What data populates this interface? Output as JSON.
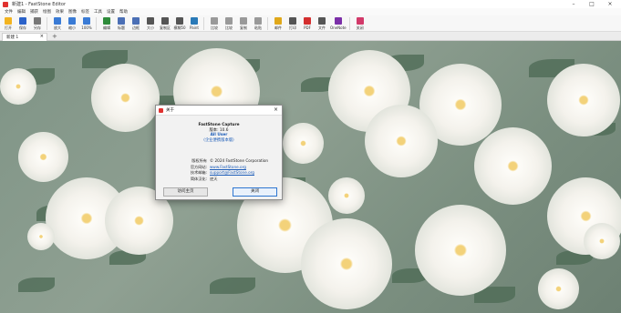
{
  "window": {
    "title": "新建1 - FastStone Editor"
  },
  "menu": [
    "文件",
    "编辑",
    "捕获",
    "绘图",
    "效果",
    "图像",
    "标签",
    "工具",
    "设置",
    "帮助"
  ],
  "toolbar": [
    {
      "label": "打开",
      "icon": "folder-open-icon",
      "color": "#f2b320"
    },
    {
      "label": "保存",
      "icon": "save-icon",
      "color": "#2b62c9"
    },
    {
      "label": "另存",
      "icon": "save-as-icon",
      "color": "#777777"
    },
    {
      "label": "放大",
      "icon": "zoom-in-icon",
      "color": "#3a7bd5"
    },
    {
      "label": "缩小",
      "icon": "zoom-out-icon",
      "color": "#3a7bd5"
    },
    {
      "label": "100%",
      "icon": "actual-size-icon",
      "color": "#3a7bd5"
    },
    {
      "label": "编辑",
      "icon": "edit-icon",
      "color": "#2e8b3a"
    },
    {
      "label": "标题",
      "icon": "caption-icon",
      "color": "#4b6fb5"
    },
    {
      "label": "边框",
      "icon": "border-icon",
      "color": "#4b6fb5"
    },
    {
      "label": "大小",
      "icon": "resize-icon",
      "color": "#555555"
    },
    {
      "label": "复制区",
      "icon": "copy-area-icon",
      "color": "#555555"
    },
    {
      "label": "模糊50",
      "icon": "blur-icon",
      "color": "#555555"
    },
    {
      "label": "Paint",
      "icon": "paint-icon",
      "color": "#2a7ab8"
    },
    {
      "label": "比较",
      "icon": "compare-icon",
      "color": "#999999"
    },
    {
      "label": "比较",
      "icon": "cut-icon",
      "color": "#999999"
    },
    {
      "label": "复制",
      "icon": "copy-icon",
      "color": "#999999"
    },
    {
      "label": "粘贴",
      "icon": "paste-icon",
      "color": "#999999"
    },
    {
      "label": "邮件",
      "icon": "mail-icon",
      "color": "#e0a81a"
    },
    {
      "label": "打印",
      "icon": "print-icon",
      "color": "#555555"
    },
    {
      "label": "PDF",
      "icon": "pdf-icon",
      "color": "#d32f2f"
    },
    {
      "label": "文件",
      "icon": "file-icon",
      "color": "#555555"
    },
    {
      "label": "OneNote",
      "icon": "onenote-icon",
      "color": "#7b2fa8"
    },
    {
      "label": "关闭",
      "icon": "close-icon",
      "color": "#d23a6a"
    }
  ],
  "tab": {
    "label": "新建 1",
    "close": "×",
    "add": "+"
  },
  "dialog": {
    "title": "关于",
    "app_name": "FastStone Capture",
    "version": "版本: 10.6",
    "license": "All User",
    "license_note": "(企业便携版本版)",
    "copyright_label": "版权所有",
    "copyright": "© 2024 FastStone Corporation",
    "homepage_label": "官方网站:",
    "homepage": "www.FastStone.org",
    "support_label": "技术邮箱:",
    "support": "support@FastStone.org",
    "chinese_label": "简体汉化:",
    "chinese": "逆天",
    "btn_left": "访问主页",
    "btn_right": "关闭"
  }
}
